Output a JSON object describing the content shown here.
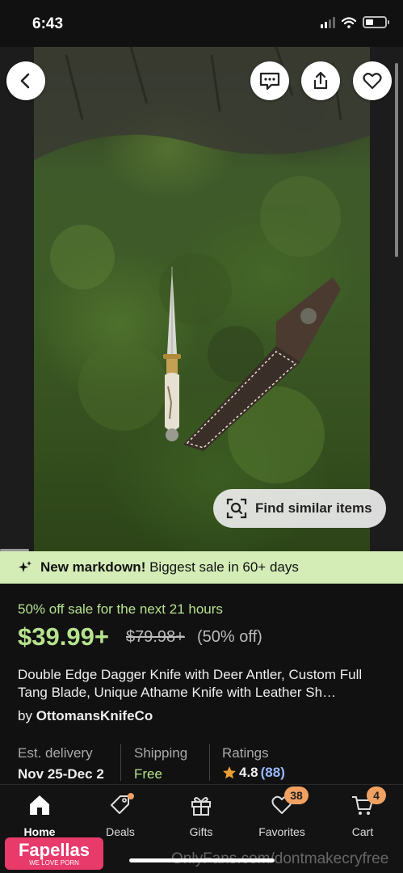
{
  "status": {
    "time": "6:43"
  },
  "hero": {
    "find_similar_label": "Find similar items"
  },
  "banner": {
    "strong": "New markdown!",
    "text": "Biggest sale in 60+ days"
  },
  "listing": {
    "sale_text": "50% off sale for the next 21 hours",
    "price": "$39.99+",
    "original_price": "$79.98+",
    "discount": "(50% off)",
    "title": "Double Edge Dagger Knife with Deer Antler, Custom Full Tang Blade, Unique Athame Knife with Leather Sh…",
    "shop_prefix": "by",
    "shop_name": "OttomansKnifeCo"
  },
  "info": {
    "delivery_label": "Est. delivery",
    "delivery_value": "Nov 25-Dec 2",
    "shipping_label": "Shipping",
    "shipping_value": "Free",
    "ratings_label": "Ratings",
    "rating_value": "4.8",
    "rating_count": "(88)"
  },
  "tabs": [
    {
      "label": "Home",
      "icon": "home-icon",
      "active": true
    },
    {
      "label": "Deals",
      "icon": "tag-icon"
    },
    {
      "label": "Gifts",
      "icon": "gift-icon"
    },
    {
      "label": "Favorites",
      "icon": "heart-icon",
      "badge": "38"
    },
    {
      "label": "Cart",
      "icon": "cart-icon",
      "badge": "4"
    }
  ],
  "overlay": {
    "watermark": "OnlyFans.com/dontmakecryfree",
    "logo_title": "Fapellas",
    "logo_sub": "WE LOVE PORN"
  },
  "colors": {
    "accent_green": "#b6e28e",
    "banner_bg": "#d4edb7",
    "badge": "#f0a060",
    "rating_count": "#9ab7ff"
  }
}
